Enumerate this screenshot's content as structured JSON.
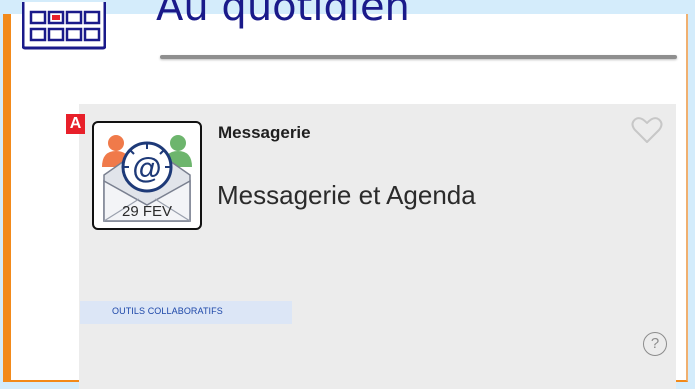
{
  "section": {
    "title": "Au quotidien",
    "icon": "calendar-icon"
  },
  "card": {
    "badge": "A",
    "category": "Messagerie",
    "title": "Messagerie et Agenda",
    "app_icon": "mail-at-icon",
    "icon_date": "29 FEV",
    "tag": "OUTILS COLLABORATIFS",
    "favorite_icon": "heart-icon",
    "help_icon": "help-icon",
    "help_symbol": "?"
  },
  "colors": {
    "accent_orange": "#f28a1b",
    "badge_red": "#e8202a",
    "title_blue": "#1a1a8a",
    "tag_bg": "#dce6f6",
    "tag_text": "#1d47a8"
  }
}
